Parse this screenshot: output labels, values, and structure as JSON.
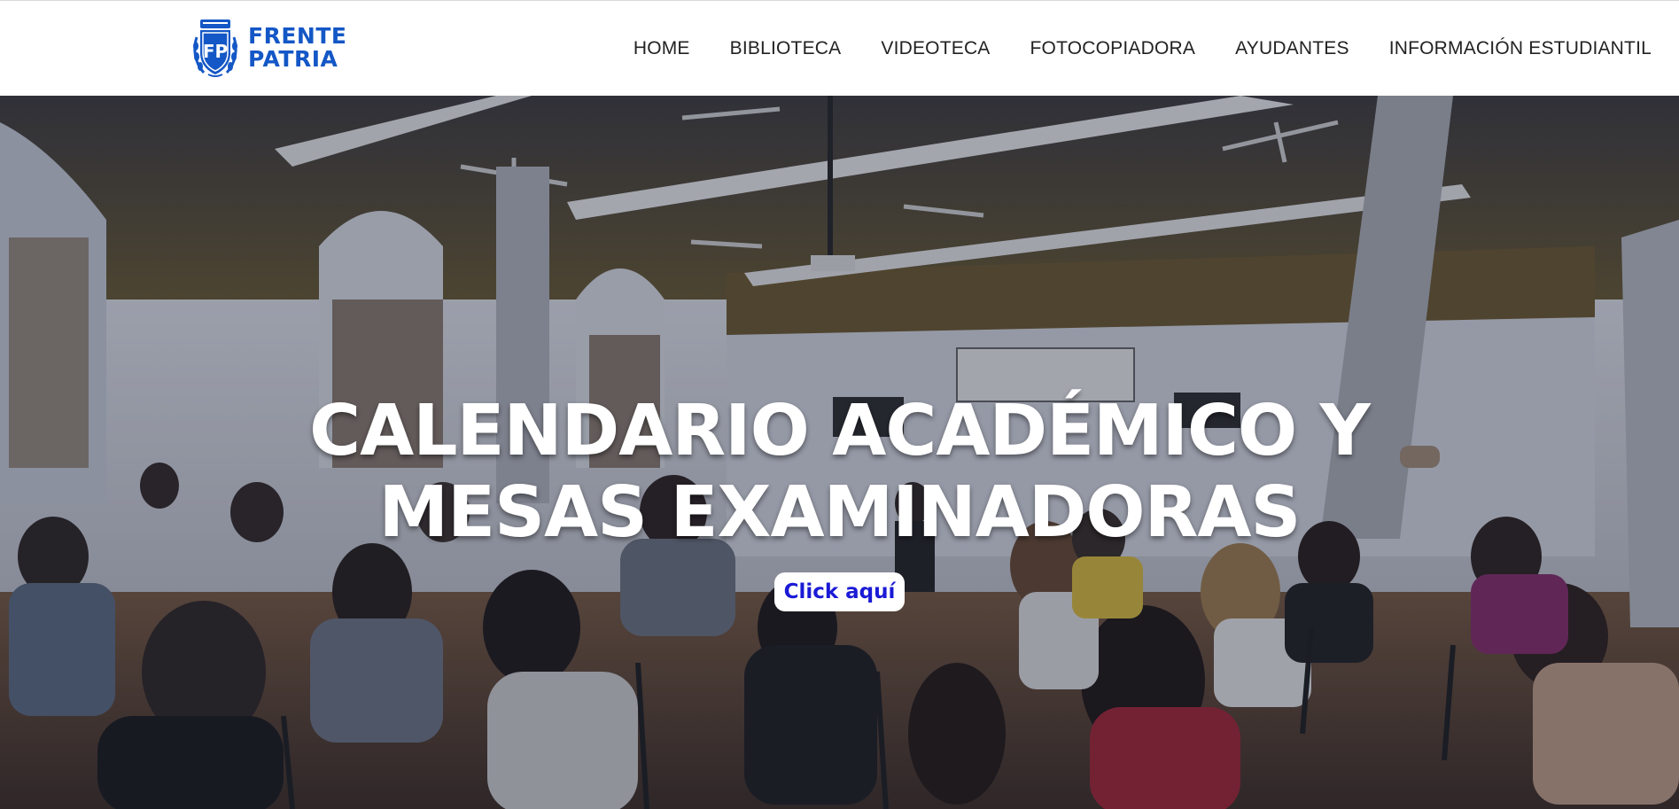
{
  "brand": {
    "logo_mark": "FP",
    "name_line1": "FRENTE",
    "name_line2": "PATRIA",
    "color": "#1457c6"
  },
  "nav": {
    "items": [
      {
        "label": "HOME"
      },
      {
        "label": "BIBLIOTECA"
      },
      {
        "label": "VIDEOTECA"
      },
      {
        "label": "FOTOCOPIADORA"
      },
      {
        "label": "AYUDANTES"
      },
      {
        "label": "INFORMACIÓN ESTUDIANTIL"
      }
    ]
  },
  "hero": {
    "title_line1": "CALENDARIO ACADÉMICO Y",
    "title_line2": "MESAS EXAMINADORAS",
    "cta_label": "Click aquí",
    "cta_color": "#1a1ad6",
    "background_image": "classroom-photo"
  }
}
